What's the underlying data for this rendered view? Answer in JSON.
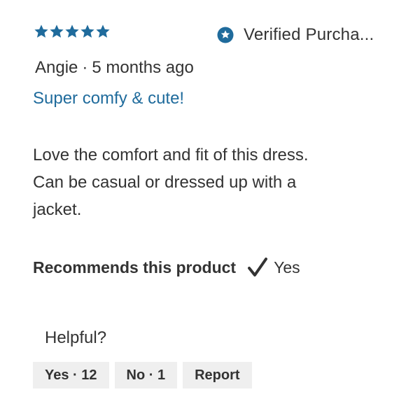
{
  "review": {
    "rating": 5,
    "max_rating": 5,
    "star_color": "#1f6b9c",
    "verified_icon": "star-badge-icon",
    "verified_label": "Verified Purcha...",
    "author": "Angie",
    "separator": "·",
    "age": "5 months ago",
    "title": "Super comfy & cute!",
    "body": "Love the comfort and fit of this dress.\nCan be casual or dressed up with a\njacket.",
    "recommend_label": "Recommends this product",
    "recommend_icon": "checkmark-icon",
    "recommend_value": "Yes"
  },
  "feedback": {
    "prompt": "Helpful?",
    "yes_label": "Yes · 12",
    "no_label": "No · 1",
    "report_label": "Report"
  }
}
